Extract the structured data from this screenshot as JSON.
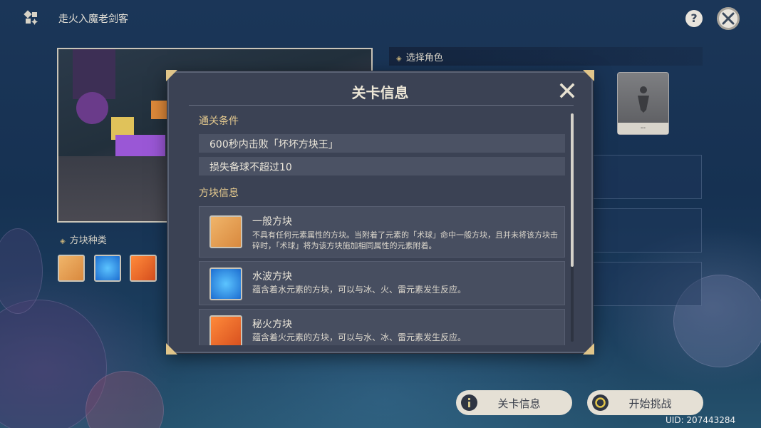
{
  "app": {
    "title": "走火入魔老剑客",
    "uid": "UID: 207443284"
  },
  "left_panel": {
    "block_types_label": "方块种类",
    "blocks": [
      {
        "icon": "normal-block-icon",
        "color": "#e9a85a"
      },
      {
        "icon": "water-block-icon",
        "color": "#2a8de0"
      },
      {
        "icon": "fire-block-icon",
        "color": "#e0662a"
      }
    ]
  },
  "right_panel": {
    "select_character_label": "选择角色",
    "character_slot_label": "--"
  },
  "buttons": {
    "stage_info": "关卡信息",
    "start_challenge": "开始挑战"
  },
  "modal": {
    "title": "关卡信息",
    "clear_conditions_heading": "通关条件",
    "conditions": [
      "600秒内击败「坏坏方块王」",
      "损失备球不超过10"
    ],
    "block_info_heading": "方块信息",
    "blocks": [
      {
        "name": "一般方块",
        "desc": "不具有任何元素属性的方块。当附着了元素的「术球」命中一般方块，且并未将该方块击碎时，「术球」将为该方块施加相同属性的元素附着。",
        "icon": "normal-block-icon",
        "color": "#e9a85a"
      },
      {
        "name": "水波方块",
        "desc": "蕴含着水元素的方块，可以与冰、火、雷元素发生反应。",
        "icon": "water-block-icon",
        "color": "#2a8de0"
      },
      {
        "name": "秘火方块",
        "desc": "蕴含着火元素的方块，可以与水、冰、雷元素发生反应。",
        "icon": "fire-block-icon",
        "color": "#e0662a"
      }
    ]
  }
}
